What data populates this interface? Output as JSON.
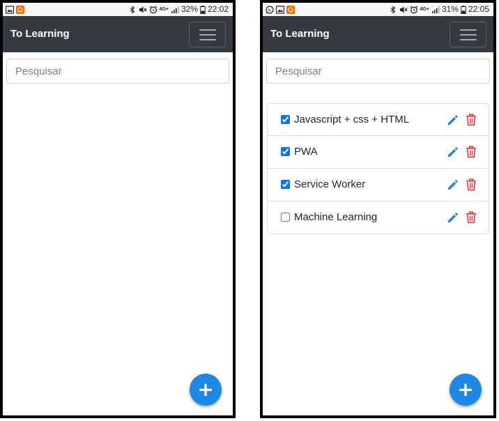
{
  "screens": [
    {
      "status_bar": {
        "battery": "32%",
        "time": "22:02",
        "network": "4G+"
      },
      "navbar": {
        "brand": "To Learning"
      },
      "search": {
        "placeholder": "Pesquisar",
        "value": ""
      },
      "fab": {
        "label": "+"
      },
      "items": []
    },
    {
      "status_bar": {
        "battery": "31%",
        "time": "22:05",
        "network": "4G+"
      },
      "navbar": {
        "brand": "To Learning"
      },
      "search": {
        "placeholder": "Pesquisar",
        "value": ""
      },
      "fab": {
        "label": "+"
      },
      "items": [
        {
          "label": "Javascript + css + HTML",
          "checked": true
        },
        {
          "label": "PWA",
          "checked": true
        },
        {
          "label": "Service Worker",
          "checked": true
        },
        {
          "label": "Machine Learning",
          "checked": false
        }
      ]
    }
  ],
  "colors": {
    "navbar": "#343a40",
    "accent": "#1e88e5",
    "edit_icon": "#1e88e5",
    "delete_icon": "#dc3545"
  },
  "icons": {
    "edit": "pencil-icon",
    "delete": "trash-icon",
    "menu": "hamburger-icon",
    "add": "plus-icon"
  }
}
